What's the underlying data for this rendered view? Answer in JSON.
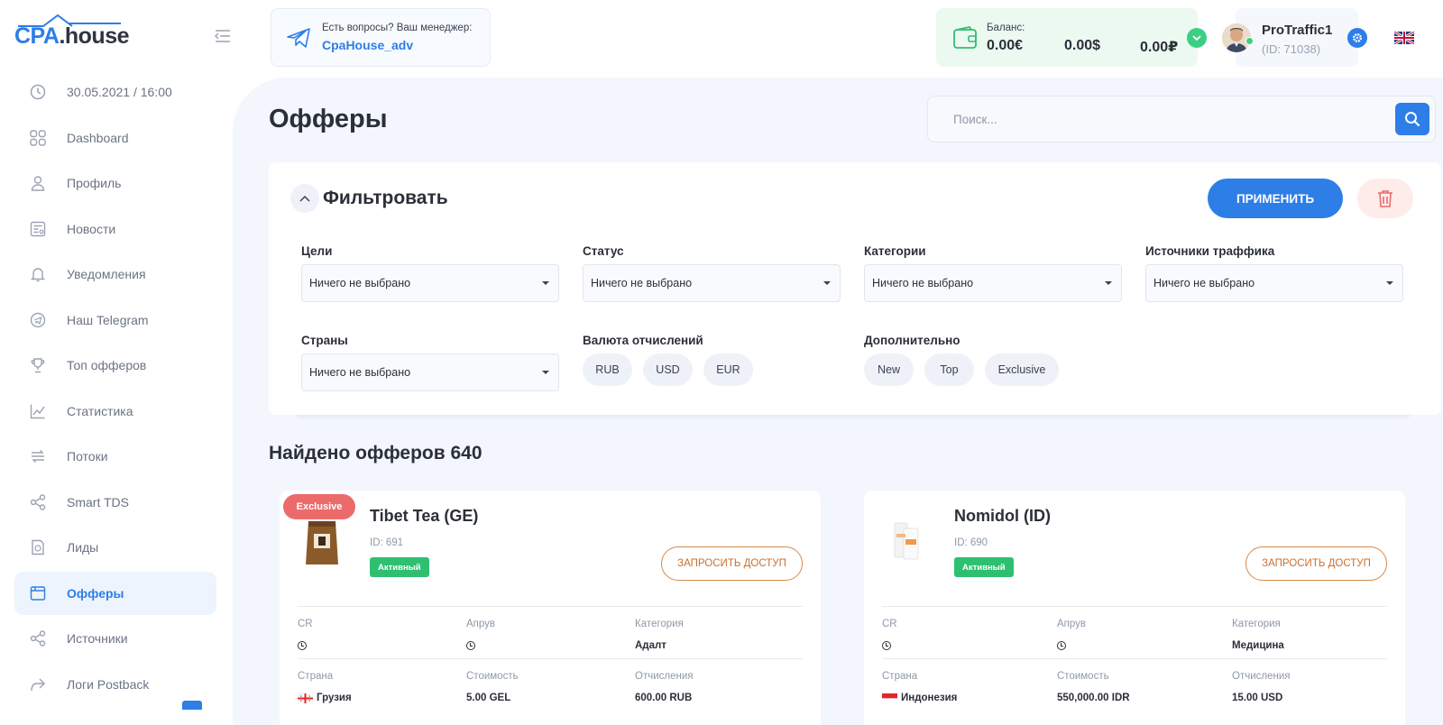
{
  "logo": {
    "part1": "CPA",
    "part2": ".house"
  },
  "sidebar": {
    "items": [
      {
        "label": "30.05.2021 / 16:00",
        "icon": "clock-icon"
      },
      {
        "label": "Dashboard",
        "icon": "dashboard-icon"
      },
      {
        "label": "Профиль",
        "icon": "user-icon"
      },
      {
        "label": "Новости",
        "icon": "news-icon"
      },
      {
        "label": "Уведомления",
        "icon": "bell-icon"
      },
      {
        "label": "Наш Telegram",
        "icon": "telegram-icon"
      },
      {
        "label": "Топ офферов",
        "icon": "trophy-icon"
      },
      {
        "label": "Статистика",
        "icon": "chart-icon"
      },
      {
        "label": "Потоки",
        "icon": "flows-icon"
      },
      {
        "label": "Smart TDS",
        "icon": "share-icon"
      },
      {
        "label": "Лиды",
        "icon": "leads-icon"
      },
      {
        "label": "Офферы",
        "icon": "offers-icon"
      },
      {
        "label": "Источники",
        "icon": "sources-icon"
      },
      {
        "label": "Логи Postback",
        "icon": "forward-icon"
      }
    ]
  },
  "header": {
    "manager_question": "Есть вопросы? Ваш менеджер:",
    "manager_name": "CpaHouse_adv",
    "balance_label": "Баланс:",
    "balance_eur": "0.00€",
    "balance_usd": "0.00$",
    "balance_rub": "0.00₽",
    "user_name": "ProTraffic1",
    "user_id": "(ID: 71038)"
  },
  "main": {
    "title": "Офферы",
    "search_placeholder": "Поиск...",
    "filter": {
      "title": "Фильтровать",
      "apply_label": "ПРИМЕНИТЬ",
      "goals_label": "Цели",
      "status_label": "Статус",
      "categories_label": "Категории",
      "traffic_label": "Источники траффика",
      "countries_label": "Страны",
      "currency_label": "Валюта отчислений",
      "extra_label": "Дополнительно",
      "none_selected": "Ничего не выбрано",
      "currencies": [
        "RUB",
        "USD",
        "EUR"
      ],
      "extras": [
        "New",
        "Top",
        "Exclusive"
      ]
    },
    "found_title": "Найдено офферов 640"
  },
  "offers": [
    {
      "badge": "Exclusive",
      "name": "Tibet Tea (GE)",
      "id": "ID: 691",
      "status": "Активный",
      "request": "ЗАПРОСИТЬ ДОСТУП",
      "cr_label": "CR",
      "approve_label": "Апрув",
      "category_label": "Категория",
      "category": "Адалт",
      "country_label": "Страна",
      "country": "Грузия",
      "cost_label": "Стоимость",
      "cost": "5.00 GEL",
      "payout_label": "Отчисления",
      "payout": "600.00 RUB"
    },
    {
      "name": "Nomidol (ID)",
      "id": "ID: 690",
      "status": "Активный",
      "request": "ЗАПРОСИТЬ ДОСТУП",
      "cr_label": "CR",
      "approve_label": "Апрув",
      "category_label": "Категория",
      "category": "Медицина",
      "country_label": "Страна",
      "country": "Индонезия",
      "cost_label": "Стоимость",
      "cost": "550,000.00 IDR",
      "payout_label": "Отчисления",
      "payout": "15.00 USD"
    }
  ],
  "colors": {
    "accent": "#2d7ee6",
    "success": "#2fbf71",
    "danger": "#eb6b6b",
    "warning": "#c8702e"
  }
}
